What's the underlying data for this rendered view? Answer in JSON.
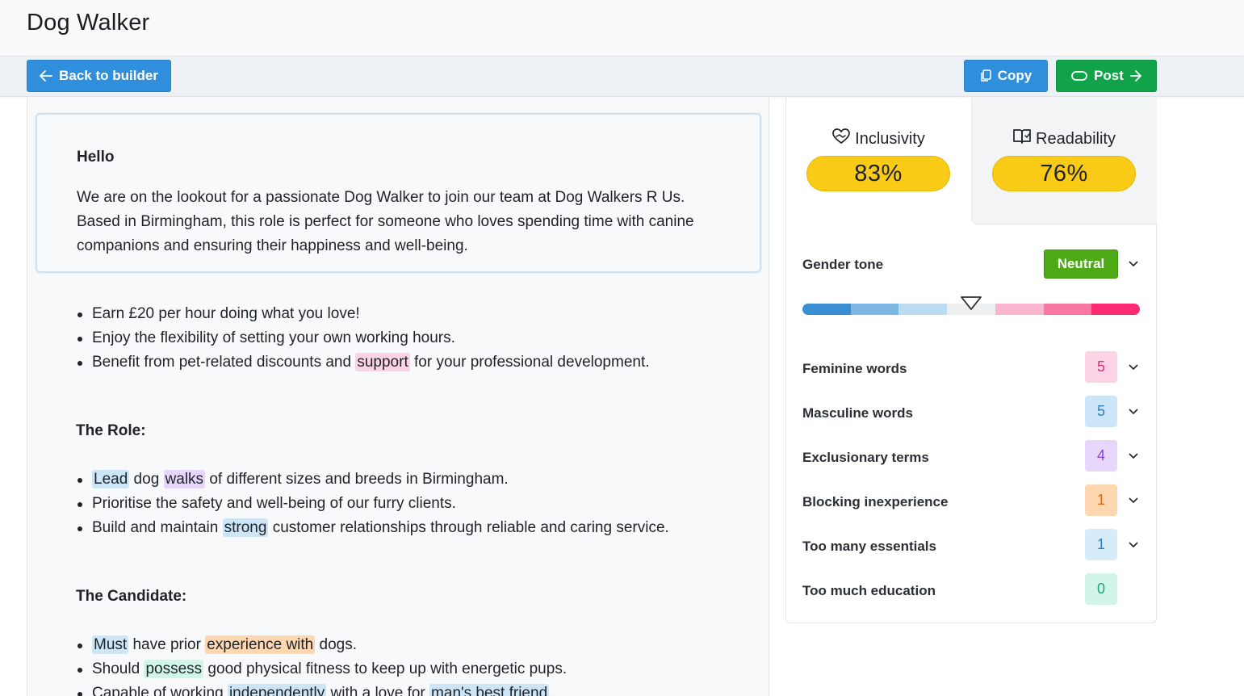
{
  "page": {
    "title": "Dog Walker"
  },
  "toolbar": {
    "back_label": "Back to builder",
    "copy_label": "Copy",
    "post_label": "Post"
  },
  "editor": {
    "greeting": "Hello",
    "intro": "We are on the lookout for a passionate Dog Walker to join our team at Dog Walkers R Us. Based in Birmingham, this role is perfect for someone who loves spending time with canine companions and ensuring their happiness and well-being.",
    "benefits": {
      "b1": "Earn £20 per hour doing what you love!",
      "b2": "Enjoy the flexibility of setting your own working hours.",
      "b3_pre": "Benefit from pet-related discounts and ",
      "b3_hl": "support",
      "b3_post": " for your professional development."
    },
    "role": {
      "heading": "The Role:",
      "r1_hl1": "Lead",
      "r1_mid": " dog ",
      "r1_hl2": "walks",
      "r1_post": " of different sizes and breeds in Birmingham.",
      "r2": "Prioritise the safety and well-being of our furry clients.",
      "r3_pre": "Build and maintain ",
      "r3_hl": "strong",
      "r3_post": " customer relationships through reliable and caring service."
    },
    "candidate": {
      "heading": "The Candidate:",
      "c1_hl1": "Must",
      "c1_mid": " have prior ",
      "c1_hl2": "experience with",
      "c1_post": " dogs.",
      "c2_pre": "Should ",
      "c2_hl": "possess",
      "c2_post": " good physical fitness to keep up with energetic pups.",
      "c3_pre": "Capable of working ",
      "c3_hl1": "independently",
      "c3_mid": " with a love for ",
      "c3_hl2": "man's best friend",
      "c3_post": "."
    }
  },
  "scores": {
    "inclusivity": {
      "label": "Inclusivity",
      "value": "83%",
      "icon": "heart-hands-icon"
    },
    "readability": {
      "label": "Readability",
      "value": "76%",
      "icon": "book-icon"
    }
  },
  "gender_tone": {
    "label": "Gender tone",
    "badge": "Neutral",
    "badge_color": "#4da916",
    "scale_colors": [
      "#3a8fd2",
      "#7cb6e2",
      "#bcdcf1",
      "#eeeff1",
      "#fbb6cf",
      "#fb77a3",
      "#fb2a72"
    ],
    "marker_icon": "triangle-down-icon"
  },
  "metrics": [
    {
      "label": "Feminine words",
      "count": "5",
      "bg": "#fbd3e4",
      "fg": "#d6306f",
      "expandable": true
    },
    {
      "label": "Masculine words",
      "count": "5",
      "bg": "#cde6f7",
      "fg": "#2f7fc0",
      "expandable": true
    },
    {
      "label": "Exclusionary terms",
      "count": "4",
      "bg": "#e6d6fb",
      "fg": "#8a3fd6",
      "expandable": true
    },
    {
      "label": "Blocking inexperience",
      "count": "1",
      "bg": "#fcd7b0",
      "fg": "#e06a14",
      "expandable": true
    },
    {
      "label": "Too many essentials",
      "count": "1",
      "bg": "#d6ecfa",
      "fg": "#2f7fc0",
      "expandable": true
    },
    {
      "label": "Too much education",
      "count": "0",
      "bg": "#d1f5e8",
      "fg": "#1aa872",
      "expandable": false
    }
  ]
}
